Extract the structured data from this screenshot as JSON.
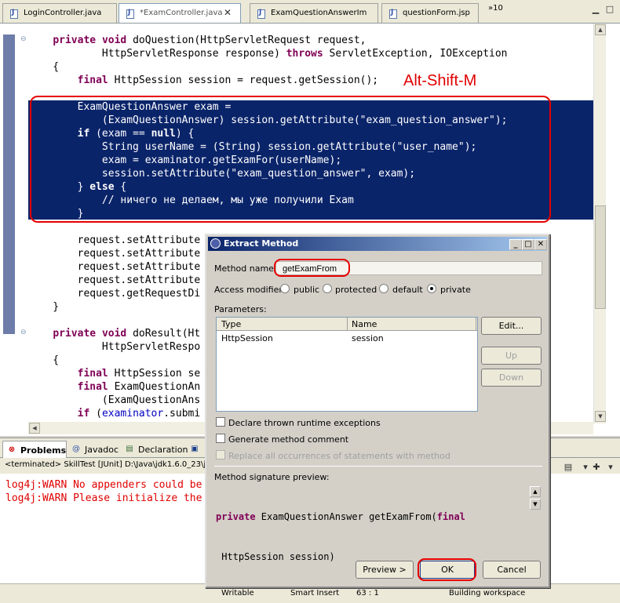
{
  "editor_tabs": [
    {
      "label": "LoginController.java",
      "active": false
    },
    {
      "label": "*ExamController.java",
      "active": true
    },
    {
      "label": "ExamQuestionAnswerIm",
      "active": false
    },
    {
      "label": "questionForm.jsp",
      "active": false
    }
  ],
  "tab_overflow": "»10",
  "code_lines": [
    {
      "parts": [
        [
          "    ",
          ""
        ],
        [
          "private",
          "kw"
        ],
        [
          " ",
          ""
        ],
        [
          "void",
          "kw"
        ],
        [
          " doQuestion(HttpServletRequest request,",
          ""
        ]
      ]
    },
    {
      "parts": [
        [
          "            HttpServletResponse response) ",
          ""
        ],
        [
          "throws",
          "kw"
        ],
        [
          " ServletException, IOException",
          ""
        ]
      ]
    },
    {
      "parts": [
        [
          "    {",
          ""
        ]
      ]
    },
    {
      "parts": [
        [
          "        ",
          ""
        ],
        [
          "final",
          "kw"
        ],
        [
          " HttpSession session = request.getSession();",
          ""
        ]
      ]
    },
    {
      "parts": [
        [
          "",
          ""
        ]
      ]
    },
    {
      "parts": [
        [
          "",
          ""
        ]
      ]
    },
    {
      "parts": [
        [
          "",
          ""
        ]
      ]
    },
    {
      "parts": [
        [
          "",
          ""
        ]
      ]
    },
    {
      "parts": [
        [
          "",
          ""
        ]
      ]
    },
    {
      "parts": [
        [
          "",
          ""
        ]
      ]
    },
    {
      "parts": [
        [
          "",
          ""
        ]
      ]
    },
    {
      "parts": [
        [
          "",
          ""
        ]
      ]
    },
    {
      "parts": [
        [
          "",
          ""
        ]
      ]
    },
    {
      "parts": [
        [
          "",
          ""
        ]
      ]
    },
    {
      "parts": [
        [
          "",
          ""
        ]
      ]
    },
    {
      "parts": [
        [
          "        request.setAttribute",
          ""
        ]
      ]
    },
    {
      "parts": [
        [
          "        request.setAttribute",
          ""
        ]
      ]
    },
    {
      "parts": [
        [
          "        request.setAttribute",
          ""
        ]
      ]
    },
    {
      "parts": [
        [
          "        request.setAttribute",
          ""
        ]
      ]
    },
    {
      "parts": [
        [
          "        request.getRequestDi",
          ""
        ]
      ]
    },
    {
      "parts": [
        [
          "    }",
          ""
        ]
      ]
    },
    {
      "parts": [
        [
          "",
          ""
        ]
      ]
    },
    {
      "parts": [
        [
          "    ",
          ""
        ],
        [
          "private",
          "kw"
        ],
        [
          " ",
          ""
        ],
        [
          "void",
          "kw"
        ],
        [
          " doResult(Ht",
          ""
        ]
      ]
    },
    {
      "parts": [
        [
          "            HttpServletRespo",
          ""
        ]
      ]
    },
    {
      "parts": [
        [
          "    {",
          ""
        ]
      ]
    },
    {
      "parts": [
        [
          "        ",
          ""
        ],
        [
          "final",
          "kw"
        ],
        [
          " HttpSession se",
          ""
        ]
      ]
    },
    {
      "parts": [
        [
          "        ",
          ""
        ],
        [
          "final",
          "kw"
        ],
        [
          " ExamQuestionAn",
          ""
        ]
      ]
    },
    {
      "parts": [
        [
          "            (ExamQuestionAns",
          ""
        ]
      ]
    },
    {
      "parts": [
        [
          "        ",
          ""
        ],
        [
          "if",
          "kw"
        ],
        [
          " (",
          ""
        ],
        [
          "examinator",
          "fld"
        ],
        [
          ".submi",
          ""
        ]
      ]
    }
  ],
  "selected_lines": [
    {
      "parts": [
        [
          "        ExamQuestionAnswer exam =",
          ""
        ]
      ]
    },
    {
      "parts": [
        [
          "            (ExamQuestionAnswer) session.getAttribute(\"exam_question_answer\");",
          ""
        ]
      ]
    },
    {
      "parts": [
        [
          "        ",
          ""
        ],
        [
          "if",
          "kw"
        ],
        [
          " (exam == ",
          ""
        ],
        [
          "null",
          "kw"
        ],
        [
          ") {",
          ""
        ]
      ]
    },
    {
      "parts": [
        [
          "            String userName = (String) session.getAttribute(\"user_name\");",
          ""
        ]
      ]
    },
    {
      "parts": [
        [
          "            exam = examinator.getExamFor(userName);",
          ""
        ]
      ]
    },
    {
      "parts": [
        [
          "            session.setAttribute(\"exam_question_answer\", exam);",
          ""
        ]
      ]
    },
    {
      "parts": [
        [
          "        } ",
          ""
        ],
        [
          "else",
          "kw"
        ],
        [
          " {",
          ""
        ]
      ]
    },
    {
      "parts": [
        [
          "            // ничего не делаем, мы уже получили Exam",
          ""
        ]
      ]
    },
    {
      "parts": [
        [
          "        }",
          ""
        ]
      ]
    }
  ],
  "shortcut_note": "Alt-Shift-M",
  "bottom_tabs": [
    {
      "label": "Problems",
      "icon": "problems-icon",
      "glyph": "⊗"
    },
    {
      "label": "Javadoc",
      "icon": "javadoc-icon",
      "glyph": "@"
    },
    {
      "label": "Declaration",
      "icon": "declaration-icon",
      "glyph": "▤"
    },
    {
      "label": "",
      "icon": "console-icon",
      "glyph": "▣"
    }
  ],
  "console_header": "<terminated> SkillTest [JUnit] D:\\Java\\jdk1.6.0_23\\j",
  "console_lines": [
    "log4j:WARN No appenders could be",
    "log4j:WARN Please initialize the"
  ],
  "status": {
    "mode": "Writable",
    "insert": "Smart Insert",
    "position": "63 : 1",
    "task": "Building workspace"
  },
  "dialog": {
    "title": "Extract Method",
    "method_name_label": "Method name:",
    "method_name_value": "getExamFrom",
    "access_label": "Access modifier:",
    "access_options": [
      {
        "label": "public",
        "selected": false
      },
      {
        "label": "protected",
        "selected": false
      },
      {
        "label": "default",
        "selected": false
      },
      {
        "label": "private",
        "selected": true
      }
    ],
    "parameters_label": "Parameters:",
    "param_columns": [
      "Type",
      "Name"
    ],
    "param_rows": [
      {
        "type": "HttpSession",
        "name": "session"
      }
    ],
    "edit_button": "Edit...",
    "up_button": "Up",
    "down_button": "Down",
    "checkboxes": [
      {
        "label": "Declare thrown runtime exceptions",
        "checked": false,
        "enabled": true
      },
      {
        "label": "Generate method comment",
        "checked": false,
        "enabled": true
      },
      {
        "label": "Replace all occurrences of statements with method",
        "checked": false,
        "enabled": false
      }
    ],
    "signature_label": "Method signature preview:",
    "signature_line1": [
      [
        "private",
        "kw"
      ],
      [
        " ExamQuestionAnswer getExamFrom(",
        ""
      ],
      [
        "final",
        "kw"
      ]
    ],
    "signature_line2": " HttpSession session)",
    "preview_button": "Preview >",
    "ok_button": "OK",
    "cancel_button": "Cancel"
  }
}
